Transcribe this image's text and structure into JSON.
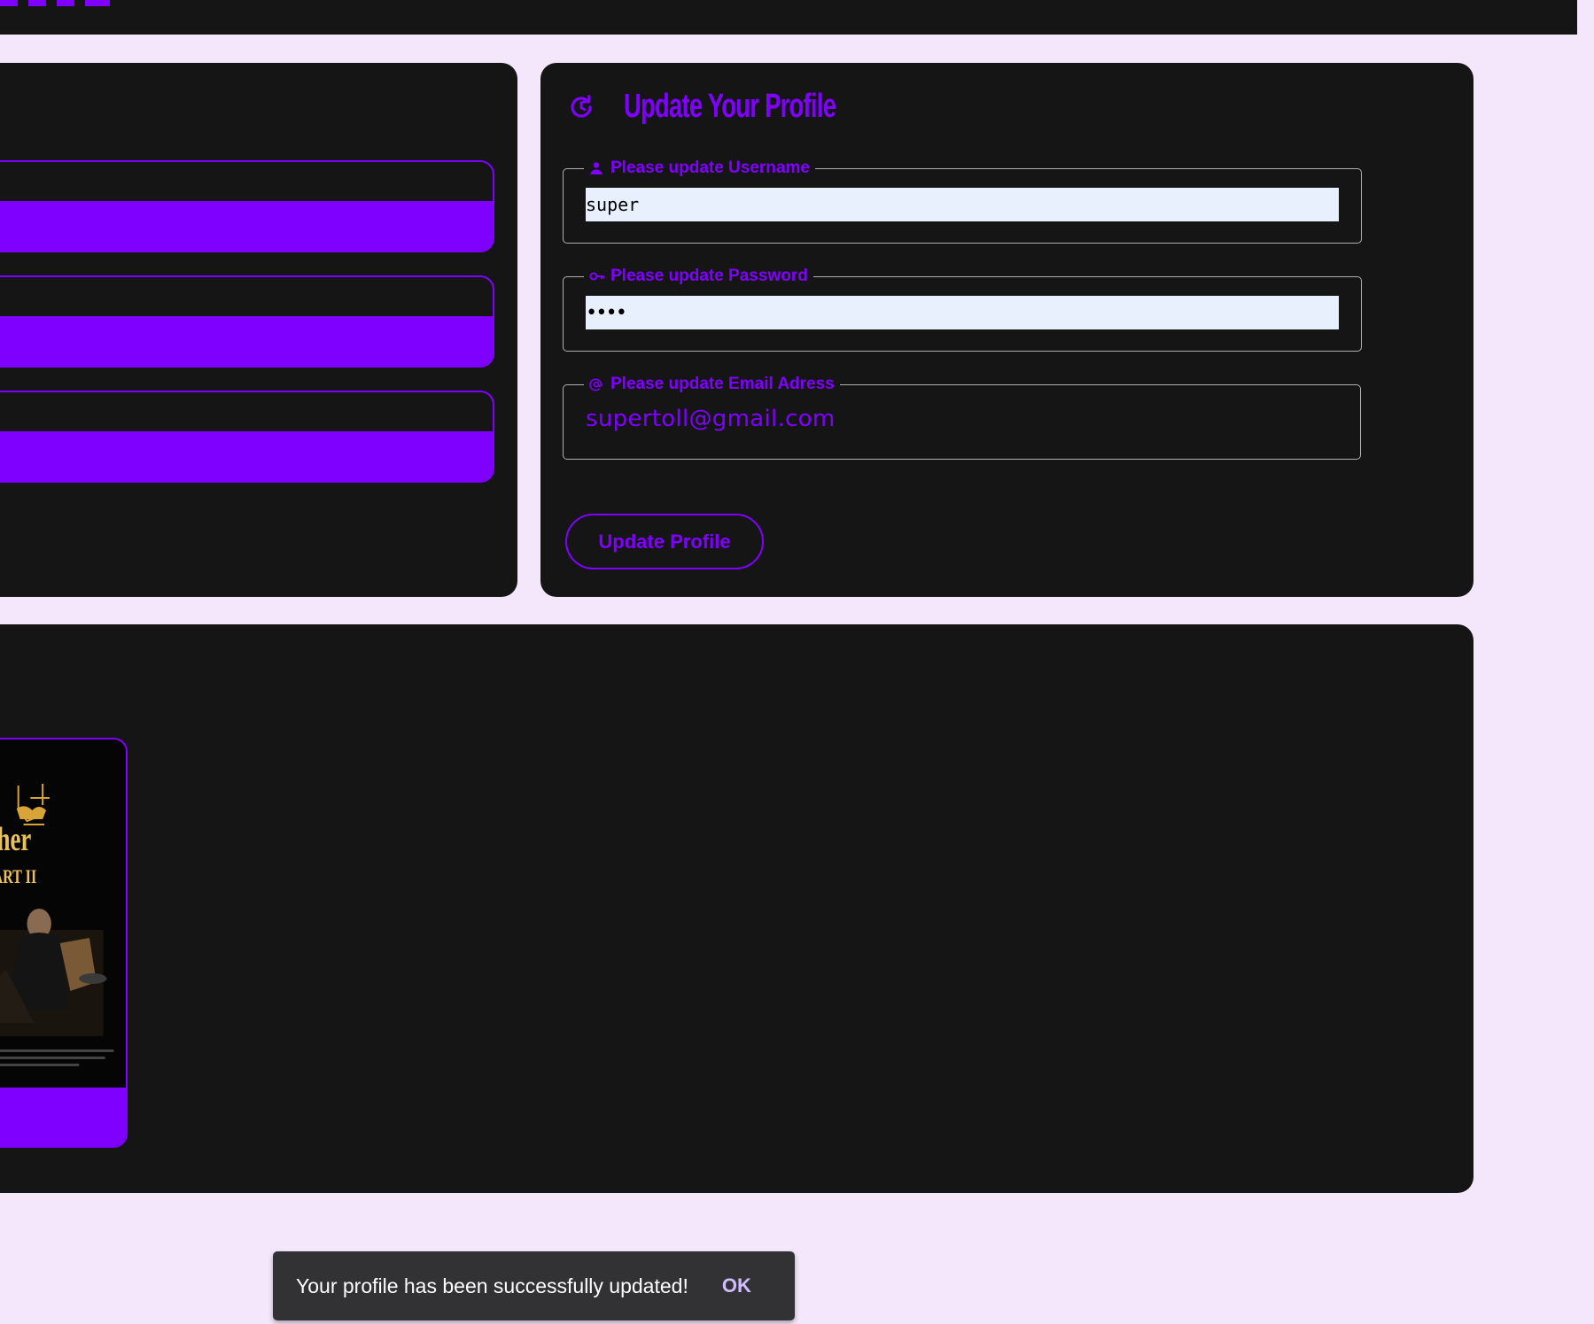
{
  "colors": {
    "page_background": "#f5e7fb",
    "card_background": "#151515",
    "accent": "#8000ff",
    "input_background": "#e8f0fe",
    "snackbar_background": "#323133",
    "snackbar_action": "#d0bcff"
  },
  "profile_form": {
    "title": "Update Your Profile",
    "title_icon": "refresh-icon",
    "username": {
      "legend": "Please update Username",
      "icon": "person-icon",
      "value": "super"
    },
    "password": {
      "legend": "Please update Password",
      "icon": "key-icon",
      "value": "••••"
    },
    "email": {
      "legend": "Please update Email Adress",
      "icon": "at-icon",
      "value": "supertoll@gmail.com"
    },
    "submit_label": "Update Profile"
  },
  "left_panel": {
    "item_count": 3
  },
  "favorites": {
    "movies": [
      {
        "poster_title": "Father",
        "poster_subtitle": "PART II"
      }
    ]
  },
  "snackbar": {
    "message": "Your profile has been successfully updated!",
    "action_label": "OK"
  }
}
